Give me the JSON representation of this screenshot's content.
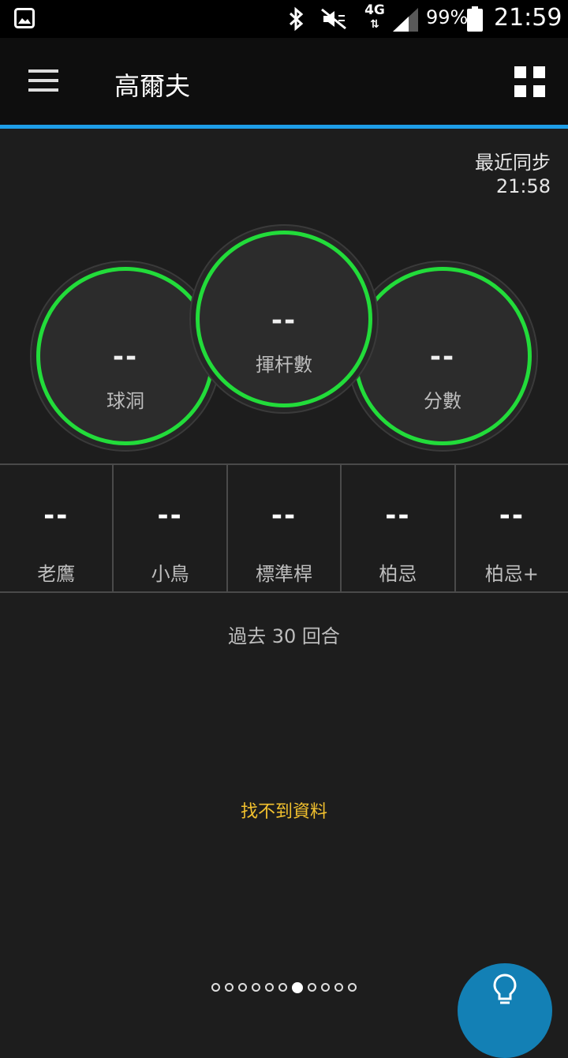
{
  "status_bar": {
    "network": "4G",
    "battery_percent": "99%",
    "time": "21:59"
  },
  "app_bar": {
    "title": "高爾夫"
  },
  "sync": {
    "label": "最近同步",
    "time": "21:58"
  },
  "circles": [
    {
      "value": "--",
      "label": "球洞"
    },
    {
      "value": "--",
      "label": "揮杆數"
    },
    {
      "value": "--",
      "label": "分數"
    }
  ],
  "stats": [
    {
      "value": "--",
      "label": "老鷹"
    },
    {
      "value": "--",
      "label": "小鳥"
    },
    {
      "value": "--",
      "label": "標準桿"
    },
    {
      "value": "--",
      "label": "柏忌"
    },
    {
      "value": "--",
      "label": "柏忌+"
    }
  ],
  "period_label": "過去 30 回合",
  "no_data_message": "找不到資料",
  "pager": {
    "total_pages": 11,
    "active_index": 6
  },
  "colors": {
    "accent": "#1e9ee8",
    "ring": "#22dc3a",
    "no_data": "#f2c12e",
    "fab": "#1380b5"
  },
  "icons": {
    "fab": "lightbulb-icon",
    "menu": "hamburger-menu-icon",
    "grid": "grid-view-icon"
  }
}
